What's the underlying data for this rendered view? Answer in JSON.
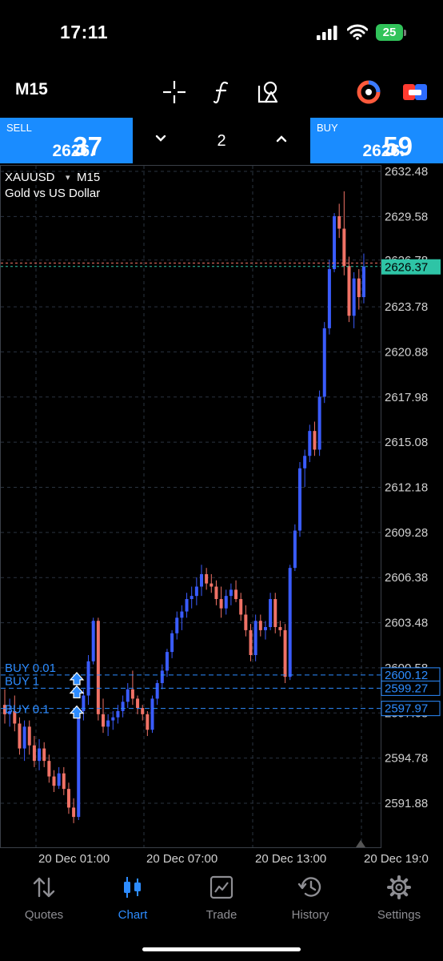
{
  "status": {
    "time": "17:11",
    "battery": "25"
  },
  "toolbar": {
    "timeframe": "M15"
  },
  "trade": {
    "sell": {
      "label": "SELL",
      "price_prefix": "2626.",
      "price_big": "37"
    },
    "buy": {
      "label": "BUY",
      "price_prefix": "2626.",
      "price_big": "59"
    },
    "volume": "2"
  },
  "chart": {
    "symbol": "XAUUSD",
    "symbol_dropdown": "▾",
    "timeframe": "M15",
    "description": "Gold vs US Dollar",
    "price_labels": [
      "2632.48",
      "2629.58",
      "2626.78",
      "2623.78",
      "2620.88",
      "2617.98",
      "2615.08",
      "2612.18",
      "2609.28",
      "2606.38",
      "2603.48",
      "2600.58",
      "2597.68",
      "2594.78",
      "2591.88"
    ],
    "current_price": "2626.37",
    "orders": [
      {
        "label": "BUY 0.01",
        "price": "2600.12"
      },
      {
        "label": "BUY 1",
        "price": "2599.27"
      },
      {
        "label": "BUY 0.1",
        "price": "2597.97"
      }
    ],
    "time_labels": [
      "20 Dec 01:00",
      "20 Dec 07:00",
      "20 Dec 13:00",
      "20 Dec 19:0"
    ],
    "colors": {
      "bull": "#3a5cff",
      "bear": "#f07266",
      "grid": "#2a3340",
      "bid_line": "#2ec4a6",
      "ask_line": "#f07266",
      "order_line": "#2d8cff"
    }
  },
  "chart_data": {
    "type": "candlestick",
    "symbol": "XAUUSD",
    "timeframe": "M15",
    "ylim": [
      2589.5,
      2633.5
    ],
    "candles": [
      [
        2598.2,
        2599.2,
        2597.0,
        2597.6
      ],
      [
        2597.6,
        2598.6,
        2596.8,
        2597.8
      ],
      [
        2597.8,
        2598.8,
        2596.5,
        2597.0
      ],
      [
        2597.0,
        2597.4,
        2595.0,
        2595.4
      ],
      [
        2595.4,
        2597.2,
        2594.6,
        2596.8
      ],
      [
        2596.8,
        2597.2,
        2595.0,
        2595.6
      ],
      [
        2595.6,
        2596.2,
        2594.2,
        2594.6
      ],
      [
        2594.6,
        2596.0,
        2594.0,
        2595.4
      ],
      [
        2595.4,
        2595.8,
        2594.2,
        2594.6
      ],
      [
        2594.6,
        2595.0,
        2593.2,
        2593.6
      ],
      [
        2593.6,
        2594.0,
        2592.6,
        2593.0
      ],
      [
        2593.0,
        2594.2,
        2592.8,
        2593.8
      ],
      [
        2593.8,
        2594.2,
        2592.4,
        2592.8
      ],
      [
        2592.8,
        2593.2,
        2591.2,
        2591.6
      ],
      [
        2591.6,
        2592.2,
        2590.6,
        2591.0
      ],
      [
        2591.0,
        2598.0,
        2590.8,
        2597.8
      ],
      [
        2597.8,
        2599.2,
        2597.2,
        2598.8
      ],
      [
        2598.8,
        2601.4,
        2598.2,
        2601.0
      ],
      [
        2601.0,
        2603.8,
        2600.8,
        2603.6
      ],
      [
        2603.6,
        2603.8,
        2597.2,
        2597.6
      ],
      [
        2597.6,
        2598.6,
        2596.4,
        2596.8
      ],
      [
        2596.8,
        2597.6,
        2596.2,
        2597.2
      ],
      [
        2597.2,
        2597.8,
        2596.6,
        2597.4
      ],
      [
        2597.4,
        2598.2,
        2597.0,
        2597.8
      ],
      [
        2597.8,
        2598.8,
        2597.4,
        2598.4
      ],
      [
        2598.4,
        2599.6,
        2598.0,
        2599.2
      ],
      [
        2599.2,
        2600.4,
        2598.2,
        2598.6
      ],
      [
        2598.6,
        2598.8,
        2597.6,
        2598.0
      ],
      [
        2598.0,
        2598.2,
        2597.2,
        2597.6
      ],
      [
        2597.6,
        2597.8,
        2596.2,
        2596.6
      ],
      [
        2596.6,
        2598.8,
        2596.4,
        2598.6
      ],
      [
        2598.6,
        2599.8,
        2598.2,
        2599.6
      ],
      [
        2599.6,
        2600.8,
        2599.2,
        2600.4
      ],
      [
        2600.4,
        2601.8,
        2600.0,
        2601.6
      ],
      [
        2601.6,
        2603.0,
        2601.2,
        2602.8
      ],
      [
        2602.8,
        2604.2,
        2602.4,
        2603.8
      ],
      [
        2603.8,
        2604.6,
        2603.0,
        2604.2
      ],
      [
        2604.2,
        2605.4,
        2603.8,
        2605.0
      ],
      [
        2605.0,
        2605.8,
        2604.4,
        2605.2
      ],
      [
        2605.2,
        2606.4,
        2604.6,
        2605.8
      ],
      [
        2605.8,
        2607.2,
        2605.2,
        2606.6
      ],
      [
        2606.6,
        2607.0,
        2605.6,
        2606.0
      ],
      [
        2606.0,
        2606.6,
        2605.4,
        2605.8
      ],
      [
        2605.8,
        2606.2,
        2604.6,
        2605.0
      ],
      [
        2605.0,
        2605.8,
        2603.8,
        2604.4
      ],
      [
        2604.4,
        2605.6,
        2604.0,
        2605.2
      ],
      [
        2605.2,
        2606.0,
        2604.6,
        2605.6
      ],
      [
        2605.6,
        2606.2,
        2604.8,
        2605.0
      ],
      [
        2605.0,
        2605.4,
        2603.6,
        2604.0
      ],
      [
        2604.0,
        2604.6,
        2602.6,
        2603.0
      ],
      [
        2603.0,
        2603.4,
        2601.0,
        2601.4
      ],
      [
        2601.4,
        2604.0,
        2601.0,
        2603.6
      ],
      [
        2603.6,
        2604.0,
        2602.6,
        2603.0
      ],
      [
        2603.0,
        2603.6,
        2602.4,
        2603.2
      ],
      [
        2603.2,
        2605.4,
        2603.0,
        2605.0
      ],
      [
        2605.0,
        2605.4,
        2602.8,
        2603.2
      ],
      [
        2603.2,
        2603.6,
        2602.6,
        2603.0
      ],
      [
        2603.0,
        2603.4,
        2599.6,
        2600.0
      ],
      [
        2600.0,
        2607.2,
        2599.8,
        2607.0
      ],
      [
        2607.0,
        2609.8,
        2606.8,
        2609.4
      ],
      [
        2609.4,
        2613.8,
        2609.0,
        2613.4
      ],
      [
        2613.4,
        2614.6,
        2612.2,
        2614.2
      ],
      [
        2614.2,
        2616.2,
        2613.8,
        2615.8
      ],
      [
        2615.8,
        2616.4,
        2614.2,
        2614.6
      ],
      [
        2614.6,
        2618.4,
        2614.2,
        2618.0
      ],
      [
        2618.0,
        2622.8,
        2617.6,
        2622.4
      ],
      [
        2622.4,
        2626.8,
        2622.0,
        2626.2
      ],
      [
        2626.2,
        2629.8,
        2626.0,
        2629.6
      ],
      [
        2629.6,
        2630.4,
        2628.2,
        2628.8
      ],
      [
        2628.8,
        2631.2,
        2625.8,
        2626.4
      ],
      [
        2626.4,
        2627.0,
        2622.8,
        2623.2
      ],
      [
        2623.2,
        2626.0,
        2622.4,
        2625.6
      ],
      [
        2625.6,
        2626.2,
        2623.6,
        2624.4
      ],
      [
        2624.4,
        2627.2,
        2624.0,
        2626.37
      ]
    ],
    "price_ticks": [
      2632.48,
      2629.58,
      2626.78,
      2623.78,
      2620.88,
      2617.98,
      2615.08,
      2612.18,
      2609.28,
      2606.38,
      2603.48,
      2600.58,
      2597.68,
      2594.78,
      2591.88
    ],
    "time_ticks": [
      "20 Dec 01:00",
      "20 Dec 07:00",
      "20 Dec 13:00",
      "20 Dec 19:0"
    ],
    "current_bid": 2626.37,
    "current_ask": 2626.59,
    "orders": [
      {
        "label": "BUY 0.01",
        "price": 2600.12
      },
      {
        "label": "BUY 1",
        "price": 2599.27
      },
      {
        "label": "BUY 0.1",
        "price": 2597.97
      }
    ]
  },
  "tabs": [
    {
      "label": "Quotes",
      "icon": "quotes-icon"
    },
    {
      "label": "Chart",
      "icon": "chart-icon",
      "active": true
    },
    {
      "label": "Trade",
      "icon": "trade-icon"
    },
    {
      "label": "History",
      "icon": "history-icon"
    },
    {
      "label": "Settings",
      "icon": "settings-icon"
    }
  ]
}
